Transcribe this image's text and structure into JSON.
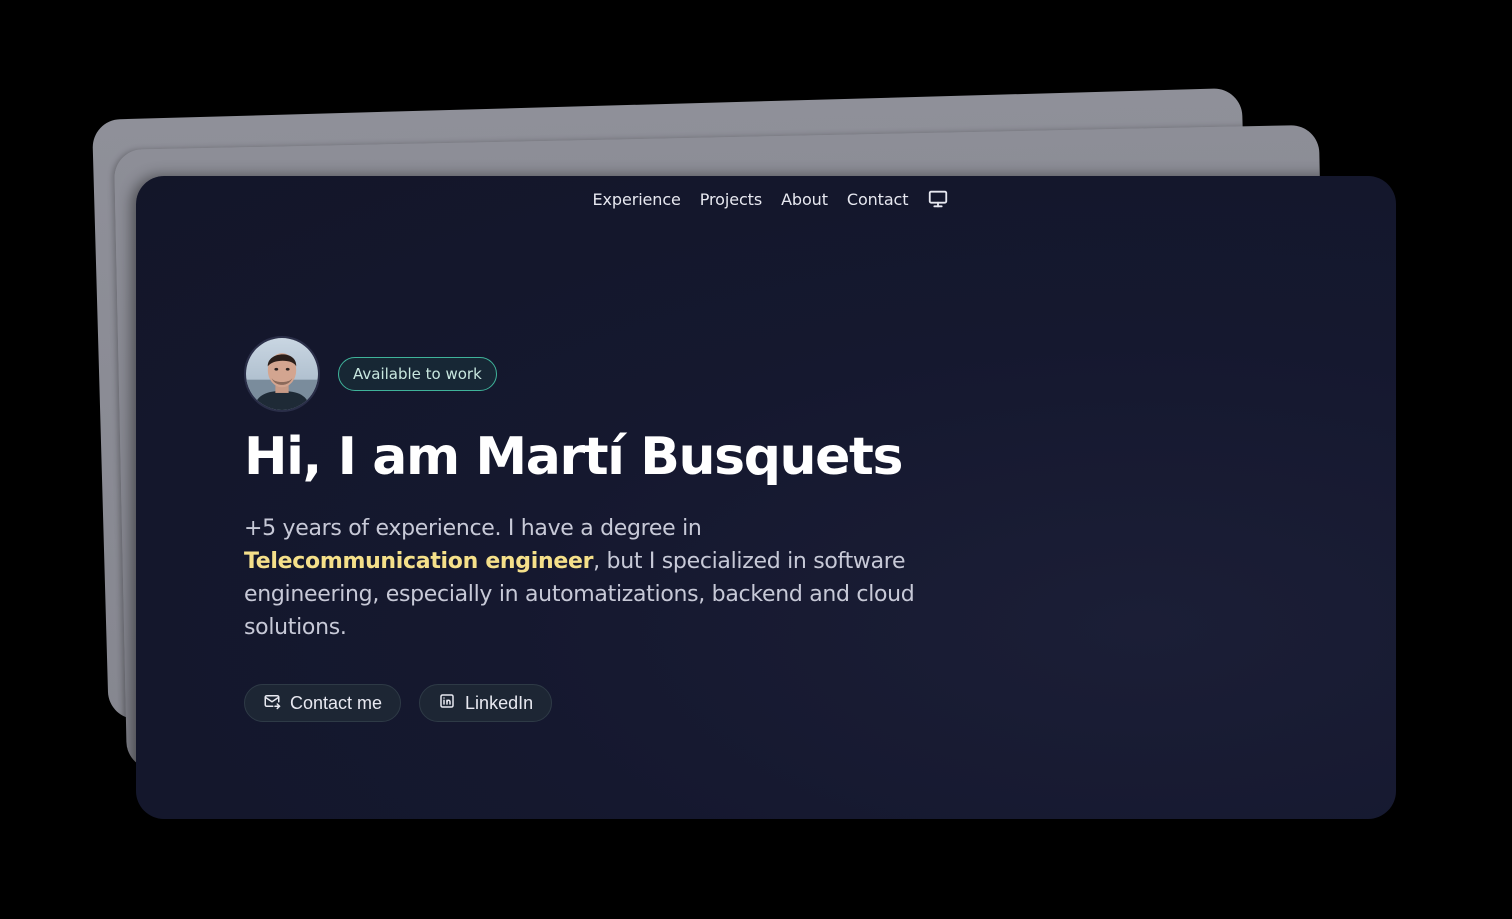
{
  "nav": {
    "items": [
      "Experience",
      "Projects",
      "About",
      "Contact"
    ],
    "theme_toggle_icon": "monitor-icon"
  },
  "hero": {
    "badge": "Available to work",
    "title": "Hi, I am Martí Busquets",
    "description": {
      "part1": "+5 years of experience. I have a degree in ",
      "highlight": "Telecommunication engineer",
      "part2": ", but I specialized in software engineering, especially in automatizations, backend and cloud solutions."
    },
    "buttons": {
      "contact": "Contact me",
      "linkedin": "LinkedIn"
    }
  },
  "colors": {
    "background": "#000000",
    "card": "#15182f",
    "accent_highlight": "#f5e08a",
    "badge_border": "#3fb39a"
  },
  "icons": {
    "contact": "mail-icon",
    "linkedin": "linkedin-icon",
    "theme": "monitor-icon"
  }
}
